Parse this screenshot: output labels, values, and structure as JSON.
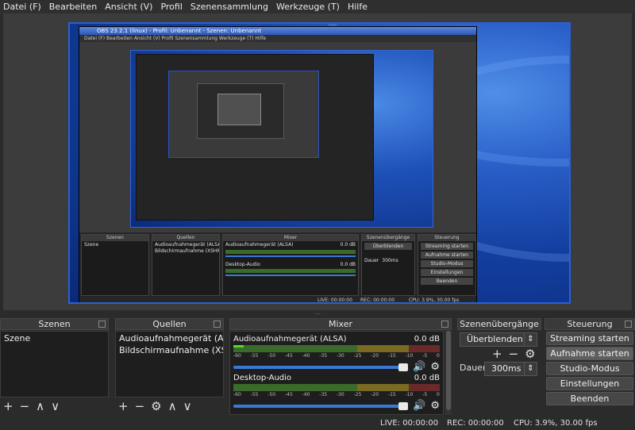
{
  "menu": [
    "Datei (F)",
    "Bearbeiten",
    "Ansicht (V)",
    "Profil",
    "Szenensammlung",
    "Werkzeuge (T)",
    "Hilfe"
  ],
  "nested": {
    "title": "OBS 23.2.1 (linux) - Profil: Unbenannt - Szenen: Unbenannt",
    "menu": "Datei (F)   Bearbeiten   Ansicht (V)   Profil   Szenensammlung   Werkzeuge (T)   Hilfe",
    "docks": [
      "Szenen",
      "Quellen",
      "Mixer",
      "Szenenübergänge",
      "Steuerung"
    ],
    "scene": "Szene",
    "sources": [
      "Audioaufnahmegerät (ALSA)",
      "Bildschirmaufnahme (XSHM)"
    ],
    "tracks": [
      "Audioaufnahmegerät (ALSA)",
      "Desktop-Audio"
    ],
    "track_db": "0.0 dB",
    "transition": "Überblenden",
    "duration_label": "Dauer",
    "duration": "300ms",
    "buttons": [
      "Streaming starten",
      "Aufnahme starten",
      "Studio-Modus",
      "Einstellungen",
      "Beenden"
    ],
    "status": {
      "live": "LIVE: 00:00:00",
      "rec": "REC: 00:00:00",
      "cpu": "CPU: 3.9%, 30.00 fps"
    }
  },
  "docks": {
    "scenes": {
      "title": "Szenen",
      "items": [
        "Szene"
      ]
    },
    "sources": {
      "title": "Quellen",
      "items": [
        "Audioaufnahmegerät (ALSA)",
        "Bildschirmaufnahme (XSHM)"
      ]
    },
    "mixer": {
      "title": "Mixer",
      "tracks": [
        {
          "name": "Audioaufnahmegerät (ALSA)",
          "db": "0.0 dB",
          "meter_level": 0.05,
          "volume": 1.0
        },
        {
          "name": "Desktop-Audio",
          "db": "0.0 dB",
          "meter_level": 0.0,
          "volume": 1.0
        }
      ],
      "scale": [
        "-60",
        "-55",
        "-50",
        "-45",
        "-40",
        "-35",
        "-30",
        "-25",
        "-20",
        "-15",
        "-10",
        "-5",
        "0"
      ]
    },
    "transitions": {
      "title": "Szenenübergänge",
      "selected": "Überblenden",
      "duration_label": "Dauer",
      "duration": "300ms"
    },
    "controls": {
      "title": "Steuerung",
      "buttons": [
        "Streaming starten",
        "Aufnahme starten",
        "Studio-Modus",
        "Einstellungen",
        "Beenden"
      ]
    }
  },
  "status": {
    "live": "LIVE: 00:00:00",
    "rec": "REC: 00:00:00",
    "cpu": "CPU: 3.9%, 30.00 fps"
  },
  "icons": {
    "add": "plus-icon",
    "remove": "minus-icon",
    "up": "chevron-up-icon",
    "down": "chevron-down-icon",
    "settings": "gear-icon",
    "mute": "speaker-icon"
  },
  "colors": {
    "accent": "#3b78d6",
    "meter_green": "#4fdc2c",
    "canvas_border": "#2a60d6"
  }
}
